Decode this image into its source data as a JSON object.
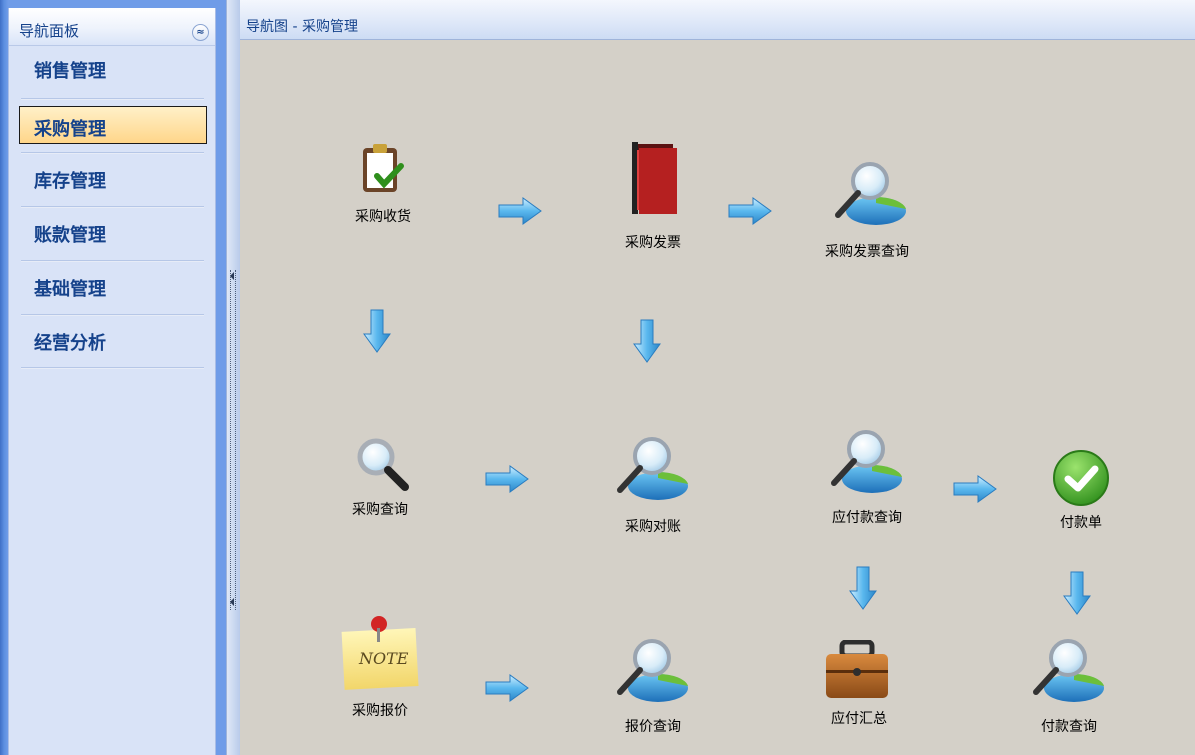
{
  "nav": {
    "title": "导航面板",
    "collapse_glyph": "≈",
    "items": [
      {
        "label": "销售管理",
        "active": false
      },
      {
        "label": "采购管理",
        "active": true
      },
      {
        "label": "库存管理",
        "active": false
      },
      {
        "label": "账款管理",
        "active": false
      },
      {
        "label": "基础管理",
        "active": false
      },
      {
        "label": "经营分析",
        "active": false
      }
    ]
  },
  "main": {
    "title": "导航图 -  采购管理",
    "nodes": {
      "receive": {
        "label": "采购收货",
        "icon": "clipboard-check-icon"
      },
      "invoice": {
        "label": "采购发票",
        "icon": "books-icon"
      },
      "invoice_query": {
        "label": "采购发票查询",
        "icon": "magnifier-chart-icon"
      },
      "purchase_query": {
        "label": "采购查询",
        "icon": "magnifier-icon"
      },
      "reconcile": {
        "label": "采购对账",
        "icon": "magnifier-chart-icon"
      },
      "payable_query": {
        "label": "应付款查询",
        "icon": "magnifier-chart-icon"
      },
      "payment": {
        "label": "付款单",
        "icon": "green-check-icon"
      },
      "quote": {
        "label": "采购报价",
        "icon": "note-icon"
      },
      "quote_query": {
        "label": "报价查询",
        "icon": "magnifier-chart-icon"
      },
      "payable_summary": {
        "label": "应付汇总",
        "icon": "briefcase-icon"
      },
      "payment_query": {
        "label": "付款查询",
        "icon": "magnifier-chart-icon"
      }
    },
    "note_text": "NOTE"
  },
  "colors": {
    "nav_text": "#15428b",
    "arrow_fill": "#5ab8ee",
    "content_bg": "#d4d0c8"
  }
}
